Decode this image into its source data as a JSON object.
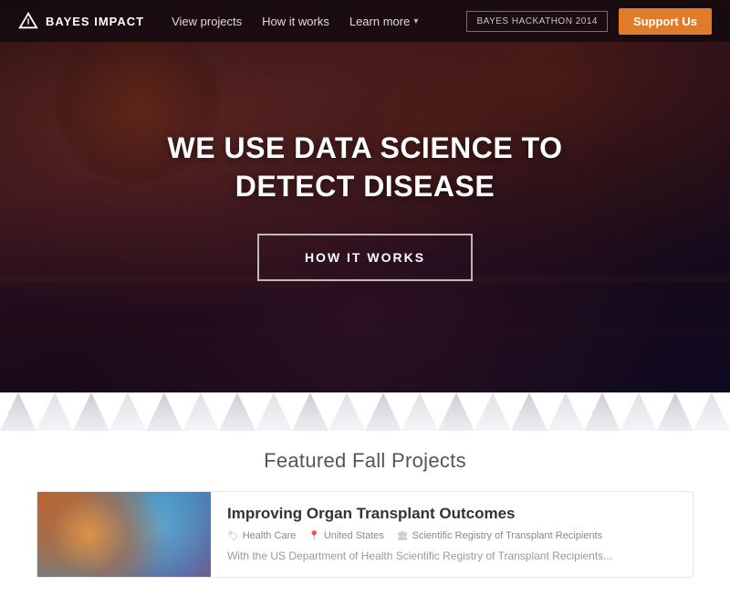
{
  "navbar": {
    "logo_text": "BAYES IMPACT",
    "nav_items": [
      {
        "label": "View projects",
        "id": "view-projects"
      },
      {
        "label": "How it works",
        "id": "how-it-works"
      },
      {
        "label": "Learn more",
        "id": "learn-more",
        "dropdown": true
      }
    ],
    "hackathon_label": "BAYES HACKATHON 2014",
    "support_label": "Support Us"
  },
  "hero": {
    "title_line1": "WE USE DATA SCIENCE TO",
    "title_line2": "DETECT DISEASE",
    "cta_label": "HOW IT WORKS"
  },
  "featured": {
    "section_title": "Featured Fall Projects",
    "project": {
      "title": "Improving Organ Transplant Outcomes",
      "tags": [
        {
          "icon": "tag",
          "label": "Health Care"
        },
        {
          "icon": "location",
          "label": "United States"
        },
        {
          "icon": "institution",
          "label": "Scientific Registry of Transplant Recipients"
        }
      ],
      "description": "With the US Department of Health Scientific Registry of Transplant Recipients..."
    }
  },
  "icons": {
    "logo_triangle": "▲",
    "dropdown_chevron": "▾",
    "tag_icon": "🏷",
    "location_icon": "📍",
    "institution_icon": "🏛"
  }
}
